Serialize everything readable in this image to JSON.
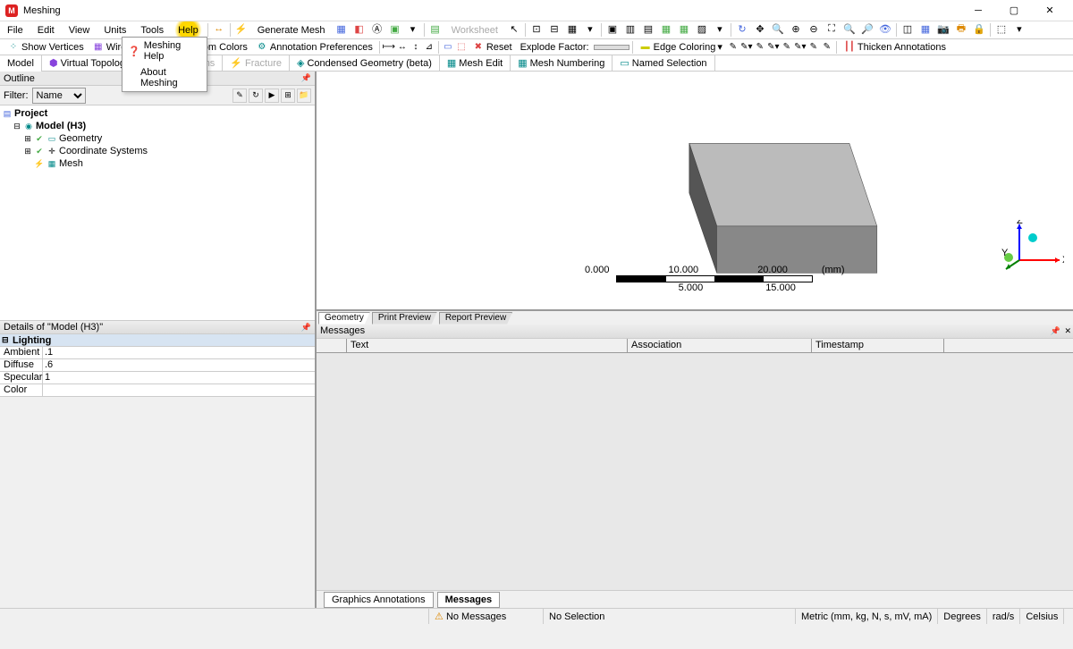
{
  "app": {
    "title": "Meshing"
  },
  "menu": {
    "items": [
      "File",
      "Edit",
      "View",
      "Units",
      "Tools",
      "Help"
    ],
    "generate": "Generate Mesh",
    "worksheet": "Worksheet",
    "highlighted_index": 5
  },
  "help_dropdown": {
    "items": [
      "Meshing Help",
      "About Meshing"
    ]
  },
  "toolbar2": {
    "show_vertices": "Show Vertices",
    "wireframe": "Wireframe",
    "random_colors": "Random Colors",
    "annotation_prefs": "Annotation Preferences",
    "edge_coloring": "Edge Coloring",
    "explode_label": "Explode Factor:",
    "reset": "Reset",
    "thicken": "Thicken Annotations"
  },
  "tabs": {
    "items": [
      {
        "label": "Model",
        "active": true
      },
      {
        "label": "Virtual Topology",
        "active": false
      },
      {
        "label": "Connections",
        "active": false,
        "disabled": true
      },
      {
        "label": "Fracture",
        "active": false,
        "disabled": true
      },
      {
        "label": "Condensed Geometry (beta)",
        "active": false
      },
      {
        "label": "Mesh Edit",
        "active": false
      },
      {
        "label": "Mesh Numbering",
        "active": false
      },
      {
        "label": "Named Selection",
        "active": false
      }
    ]
  },
  "outline": {
    "title": "Outline",
    "filter_label": "Filter:",
    "filter_value": "Name",
    "tree": {
      "root": "Project",
      "model": "Model (H3)",
      "children": [
        "Geometry",
        "Coordinate Systems",
        "Mesh"
      ]
    }
  },
  "details": {
    "title": "Details of \"Model (H3)\"",
    "group": "Lighting",
    "rows": [
      {
        "key": "Ambient",
        "val": ".1"
      },
      {
        "key": "Diffuse",
        "val": ".6"
      },
      {
        "key": "Specular",
        "val": "1"
      },
      {
        "key": "Color",
        "val": ""
      }
    ]
  },
  "viewport": {
    "scale": {
      "unit": "(mm)",
      "ticks": [
        "0.000",
        "5.000",
        "10.000",
        "15.000",
        "20.000"
      ]
    },
    "triad": {
      "x": "X",
      "y": "Y",
      "z": "Z"
    },
    "tabs": [
      "Geometry",
      "Print Preview",
      "Report Preview"
    ]
  },
  "messages": {
    "title": "Messages",
    "cols": [
      "",
      "Text",
      "Association",
      "Timestamp"
    ],
    "bottom_tabs": [
      "Graphics Annotations",
      "Messages"
    ]
  },
  "status": {
    "no_messages": "No Messages",
    "no_selection": "No Selection",
    "units": "Metric (mm, kg, N, s, mV, mA)",
    "angle": "Degrees",
    "angvel": "rad/s",
    "temp": "Celsius"
  }
}
